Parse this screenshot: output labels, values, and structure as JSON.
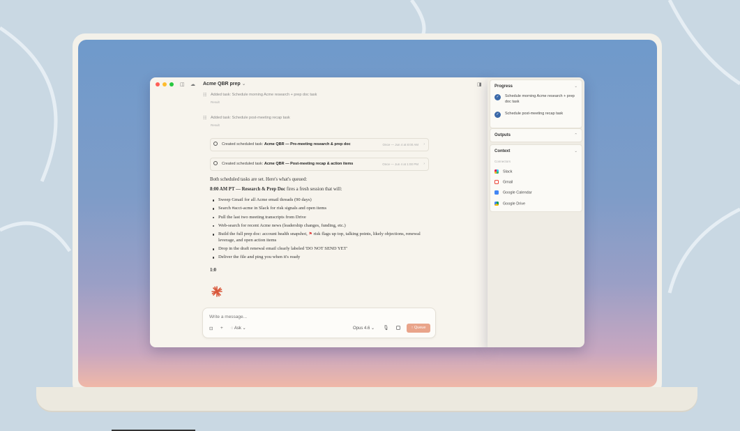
{
  "window": {
    "title": "Acme QBR prep",
    "title_chevron": "⌄"
  },
  "log": [
    {
      "text": "Added task: Schedule morning Acme research + prep doc task",
      "result": "Result"
    },
    {
      "text": "Added task: Schedule post-meeting recap task",
      "result": "Result"
    }
  ],
  "scheduled": [
    {
      "prefix": "Created scheduled task: ",
      "name": "Acme QBR — Pre-meeting research & prep doc",
      "when": "Once — Jun 4 at 8:00 AM"
    },
    {
      "prefix": "Created scheduled task: ",
      "name": "Acme QBR — Post-meeting recap & action items",
      "when": "Once — Jun 4 at 1:00 PM"
    }
  ],
  "message": {
    "intro": "Both scheduled tasks are set. Here's what's queued:",
    "heading_bold": "8:00 AM PT — Research & Prep Doc",
    "heading_rest": " fires a fresh session that will:",
    "bullets": [
      "Sweep Gmail for all Acme email threads (90 days)",
      "Search #acct-acme in Slack for risk signals and open items",
      "Pull the last two meeting transcripts from Drive",
      "Web-search for recent Acme news (leadership changes, funding, etc.)",
      "Drop in the draft renewal email clearly labeled 'DO NOT SEND YET'",
      "Deliver the file and ping you when it's ready"
    ],
    "bullet_flag_pre": "Build the full prep doc: account health snapshot,",
    "bullet_flag_post": " risk flags up top, talking points, likely objections, renewal leverage, and open action items",
    "time_label": "1:0"
  },
  "composer": {
    "placeholder": "Write a message...",
    "mode": "Ask",
    "model": "Opus 4.6",
    "queue_label": "Queue"
  },
  "side": {
    "progress": {
      "title": "Progress",
      "items": [
        "Schedule morning Acme research + prep doc task",
        "Schedule post-meeting recap task"
      ]
    },
    "outputs": {
      "title": "Outputs"
    },
    "context": {
      "title": "Context",
      "subtitle": "Connectors",
      "connectors": [
        "Slack",
        "Gmail",
        "Google Calendar",
        "Google Drive"
      ]
    }
  },
  "colors": {
    "accent": "#3a68a8",
    "queue": "#e9a48a",
    "traffic_red": "#ff5f57",
    "traffic_yellow": "#febc2e",
    "traffic_green": "#28c840"
  }
}
